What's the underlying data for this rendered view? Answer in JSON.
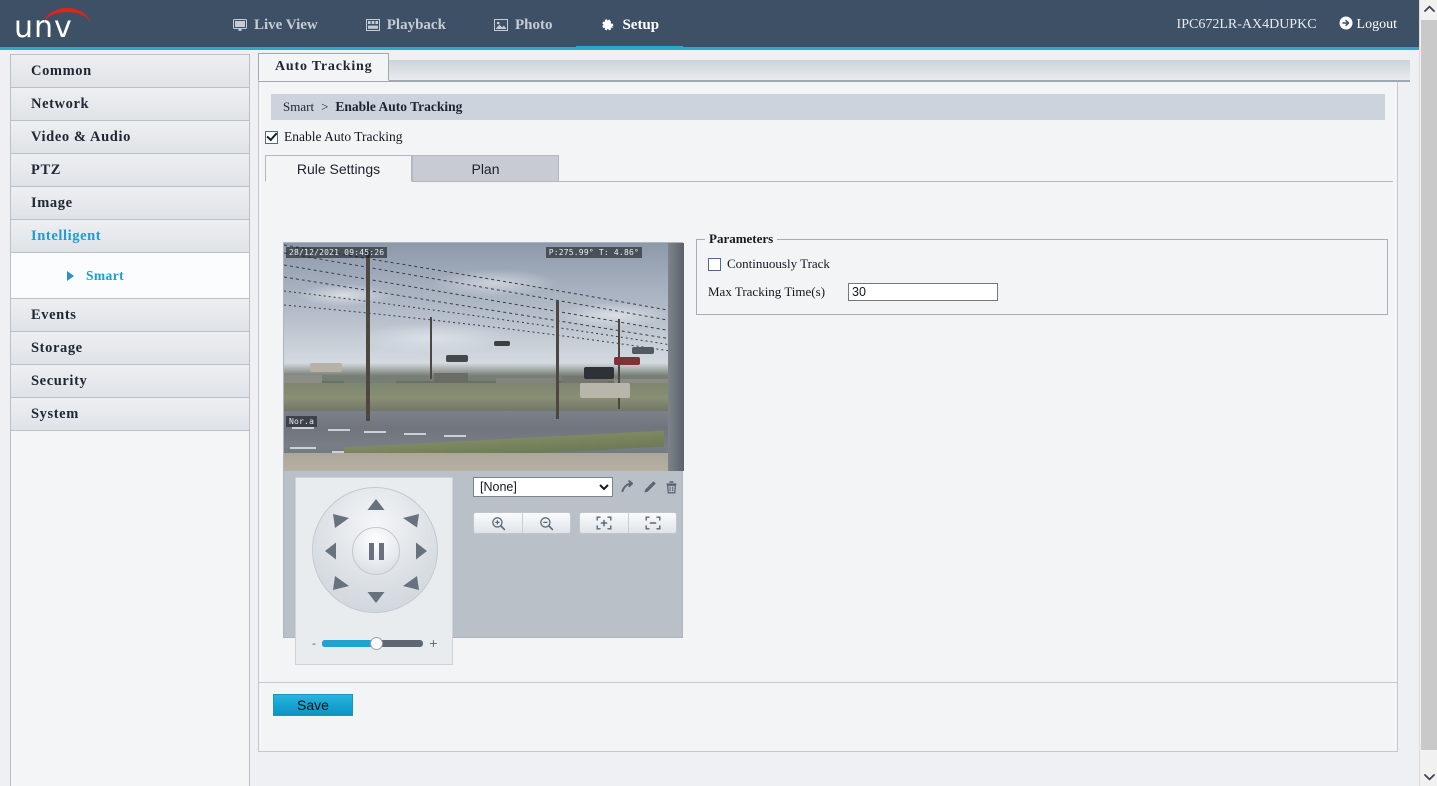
{
  "header": {
    "logo_text": "unv",
    "nav": [
      {
        "label": "Live View",
        "icon": "monitor-icon",
        "active": false
      },
      {
        "label": "Playback",
        "icon": "film-icon",
        "active": false
      },
      {
        "label": "Photo",
        "icon": "picture-icon",
        "active": false
      },
      {
        "label": "Setup",
        "icon": "gear-icon",
        "active": true
      }
    ],
    "device_name": "IPC672LR-AX4DUPKC",
    "logout_label": "Logout",
    "accent_color": "#2aa8cf",
    "background_color": "#3d5066"
  },
  "sidebar": {
    "items": [
      {
        "label": "Common",
        "selected": false
      },
      {
        "label": "Network",
        "selected": false
      },
      {
        "label": "Video & Audio",
        "selected": false
      },
      {
        "label": "PTZ",
        "selected": false
      },
      {
        "label": "Image",
        "selected": false
      },
      {
        "label": "Intelligent",
        "selected": true
      },
      {
        "label": "Events",
        "selected": false
      },
      {
        "label": "Storage",
        "selected": false
      },
      {
        "label": "Security",
        "selected": false
      },
      {
        "label": "System",
        "selected": false
      }
    ],
    "sub_item": {
      "label": "Smart",
      "selected": true
    },
    "selected_color": "#1a9dd9"
  },
  "content": {
    "tab": "Auto Tracking",
    "breadcrumb": {
      "root": "Smart",
      "separator": ">",
      "leaf": "Enable Auto Tracking"
    },
    "enable_checkbox": {
      "label": "Enable Auto Tracking",
      "checked": true
    },
    "inner_tabs": [
      {
        "label": "Rule Settings",
        "active": true
      },
      {
        "label": "Plan",
        "active": false
      }
    ],
    "save_label": "Save"
  },
  "preview": {
    "timestamp_overlay": "28/12/2021 09:45:26",
    "pt_overlay": "P:275.99°  T: 4.86°",
    "site_overlay": "Nor.a",
    "description": "Live camera view of a road intersection and parking lot under overcast sky"
  },
  "ptz": {
    "center_button": "pause-button",
    "directions": [
      "up",
      "up-right",
      "right",
      "down-right",
      "down",
      "down-left",
      "left",
      "up-left"
    ],
    "speed_slider": {
      "minus": "-",
      "plus": "+",
      "value_percent": 52
    },
    "preset_select": {
      "selected": "[None]",
      "options": [
        "[None]"
      ]
    },
    "preset_actions": [
      {
        "name": "goto-preset-icon",
        "glyph": "arrow"
      },
      {
        "name": "edit-preset-icon",
        "glyph": "pencil"
      },
      {
        "name": "delete-preset-icon",
        "glyph": "trash"
      }
    ],
    "zoom_buttons": [
      {
        "name": "zoom-in-button",
        "glyph": "magnifier-plus"
      },
      {
        "name": "zoom-out-button",
        "glyph": "magnifier-minus"
      }
    ],
    "focus_buttons": [
      {
        "name": "focus-near-button",
        "glyph": "bracket-plus"
      },
      {
        "name": "focus-far-button",
        "glyph": "bracket-minus"
      }
    ]
  },
  "parameters": {
    "legend": "Parameters",
    "continuously_track": {
      "label": "Continuously Track",
      "checked": false
    },
    "max_tracking_time": {
      "label": "Max Tracking Time(s)",
      "value": "30"
    }
  },
  "scrollbar": {
    "up_arrow": "chevron-up-icon",
    "down_arrow": "chevron-down-icon"
  }
}
